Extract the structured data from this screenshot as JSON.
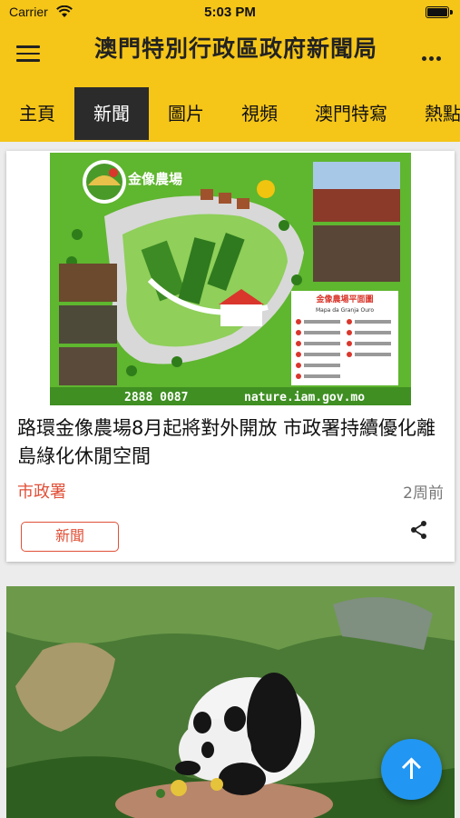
{
  "status_bar": {
    "carrier": "Carrier",
    "time": "5:03 PM"
  },
  "app_bar": {
    "title": "澳門特別行政區政府新聞局"
  },
  "tabs": [
    {
      "label": "主頁"
    },
    {
      "label": "新聞"
    },
    {
      "label": "圖片"
    },
    {
      "label": "視頻"
    },
    {
      "label": "澳門特寫"
    },
    {
      "label": "熱點"
    }
  ],
  "active_tab": "新聞",
  "articles": [
    {
      "image_text": {
        "logo_title": "金像農場",
        "map_title": "金像農場平面圖",
        "map_subtitle": "Mapa da Granja Ouro",
        "phone": "2888 0087",
        "website": "nature.iam.gov.mo"
      },
      "headline": "路環金像農場8月起將對外開放  市政署持續優化離島綠化休閒空間",
      "source": "市政署",
      "time_ago": "2周前",
      "tag": "新聞"
    }
  ],
  "colors": {
    "header": "#f5c518",
    "accent": "#e05038",
    "fab": "#2196f3"
  },
  "icons": {
    "menu": "menu-icon",
    "more": "more-icon",
    "share": "share-icon",
    "fab": "arrow-up-icon",
    "wifi": "wifi-icon"
  }
}
